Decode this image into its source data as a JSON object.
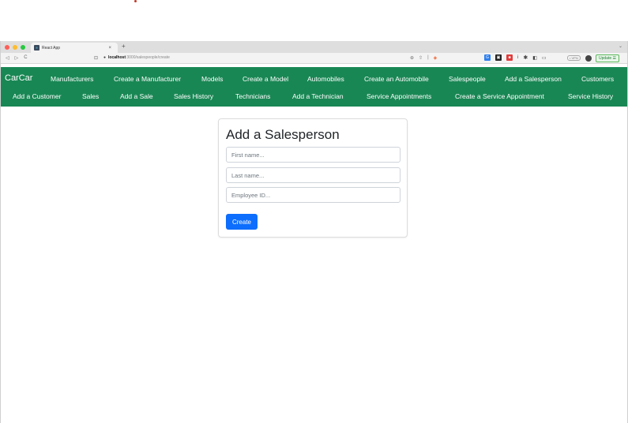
{
  "browser": {
    "tab_title": "React App",
    "tab_close": "×",
    "new_tab": "+",
    "url_host": "localhost",
    "url_path": ":3000/salespeople/create",
    "vpn_label": "• VPN",
    "update_label": "Update",
    "traffic_light_colors": [
      "#ff5f57",
      "#febc2e",
      "#28c840"
    ],
    "nav_back": "◁",
    "nav_forward": "▷",
    "nav_reload": "C"
  },
  "navbar": {
    "brand": "CarCar",
    "bg_color": "#198754",
    "row1": [
      "Manufacturers",
      "Create a Manufacturer",
      "Models",
      "Create a Model",
      "Automobiles",
      "Create an Automobile",
      "Salespeople",
      "Add a Salesperson",
      "Customers"
    ],
    "row2": [
      "Add a Customer",
      "Sales",
      "Add a Sale",
      "Sales History",
      "Technicians",
      "Add a Technician",
      "Service Appointments",
      "Create a Service Appointment",
      "Service History"
    ]
  },
  "form": {
    "title": "Add a Salesperson",
    "first_name_placeholder": "First name...",
    "last_name_placeholder": "Last name...",
    "employee_id_placeholder": "Employee ID...",
    "submit_label": "Create",
    "button_color": "#0d6efd"
  }
}
